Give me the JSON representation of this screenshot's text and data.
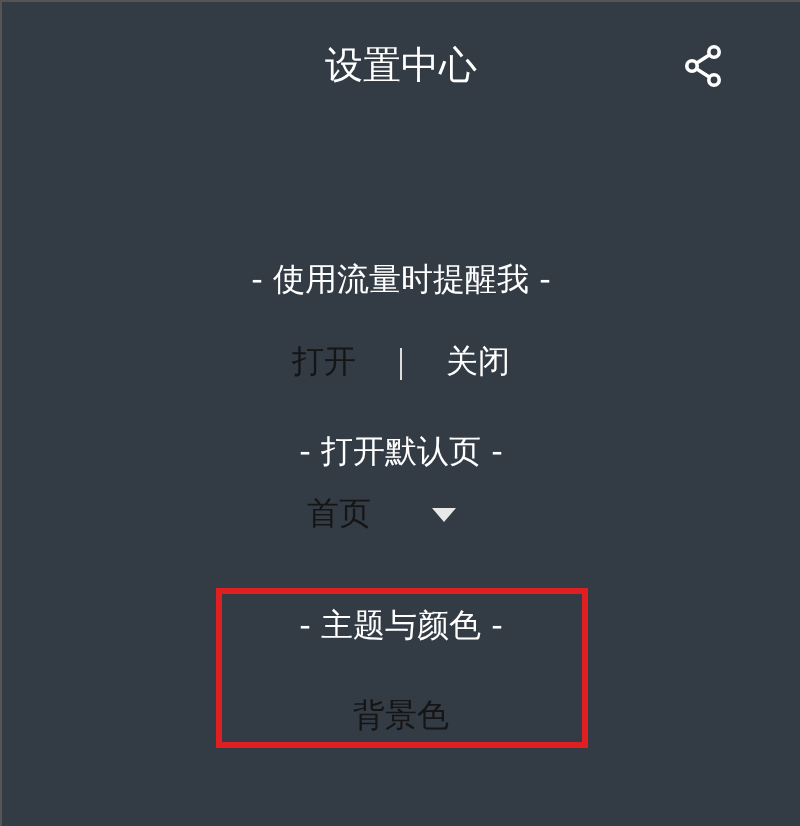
{
  "header": {
    "title": "设置中心"
  },
  "sections": [
    {
      "kind": "toggle",
      "title": "- 使用流量时提醒我 -",
      "highlighted": false,
      "options": [
        {
          "label": "打开",
          "selected": true
        },
        {
          "label": "关闭",
          "selected": false
        }
      ]
    },
    {
      "kind": "dropdown",
      "title": "- 打开默认页 -",
      "highlighted": false,
      "value": "首页"
    },
    {
      "kind": "link",
      "title": "- 主题与颜色 -",
      "highlighted": true,
      "label": "背景色"
    }
  ]
}
